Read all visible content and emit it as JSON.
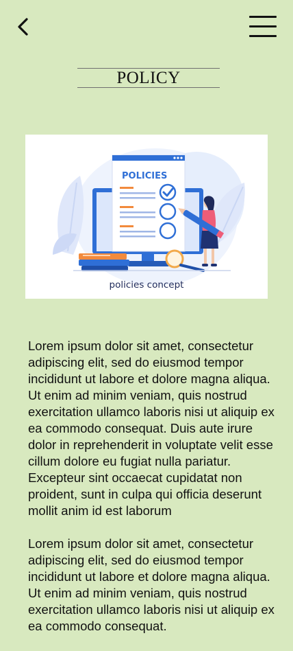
{
  "header": {
    "back_icon": "chevron-left-icon",
    "menu_icon": "hamburger-menu-icon",
    "title": "POLICY"
  },
  "hero": {
    "image_heading": "POLICIES",
    "caption": "policies concept"
  },
  "content": {
    "paragraphs": [
      "Lorem ipsum dolor sit amet, consectetur adipiscing elit, sed do eiusmod tempor incididunt ut labore et dolore magna aliqua. Ut enim ad minim veniam, quis nostrud exercitation ullamco laboris nisi ut aliquip ex ea commodo consequat. Duis aute irure dolor in reprehenderit in voluptate velit esse cillum dolore eu fugiat nulla pariatur. Excepteur sint occaecat cupidatat non proident, sunt in culpa qui officia deserunt mollit anim id est laborum",
      "Lorem ipsum dolor sit amet, consectetur adipiscing elit, sed do eiusmod tempor incididunt ut labore et dolore magna aliqua. Ut enim ad minim veniam, quis nostrud exercitation ullamco laboris nisi ut aliquip ex ea commodo consequat."
    ]
  },
  "colors": {
    "background": "#d8e9bf",
    "text": "#111111",
    "accent_blue": "#2f6fd6",
    "accent_orange": "#f28a3c",
    "accent_pink": "#ee5d78"
  }
}
